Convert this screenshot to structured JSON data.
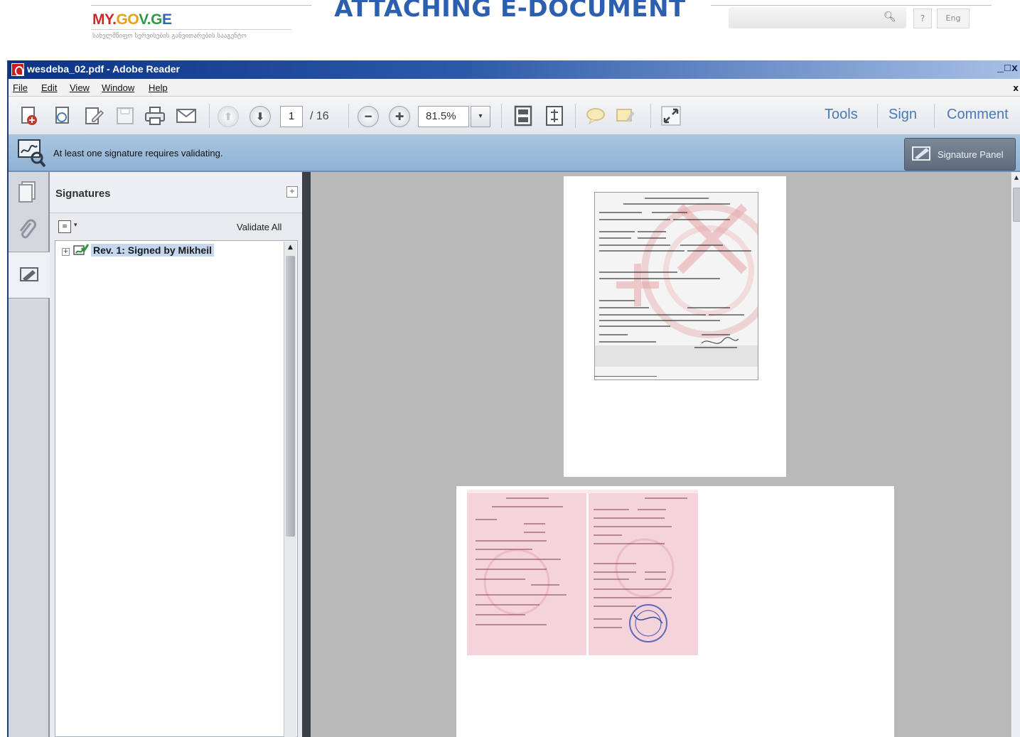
{
  "site": {
    "logo": {
      "part1": "MY.",
      "part2": "GO",
      "part3": "V.G",
      "part4": "E"
    },
    "logo_subtitle": "სახელმწიფო სერვისების განვითარების სააგენტო",
    "title": "ATTACHING E-DOCUMENT",
    "search_icon": "search-icon",
    "help_label": "?",
    "language_label": "Eng"
  },
  "window": {
    "title": "wesdeba_02.pdf - Adobe Reader",
    "controls": "_□x"
  },
  "menu": {
    "items": [
      "File",
      "Edit",
      "View",
      "Window",
      "Help"
    ],
    "close": "x"
  },
  "toolbar": {
    "current_page": "1",
    "total_pages": "/ 16",
    "zoom": "81.5%",
    "zoom_caret": "▾",
    "tools_label": "Tools",
    "sign_label": "Sign",
    "comment_label": "Comment"
  },
  "message_bar": {
    "text": "At least one signature requires validating.",
    "button_label": "Signature Panel"
  },
  "signatures_panel": {
    "title": "Signatures",
    "collapse": "+",
    "validate_all": "Validate All",
    "tree": [
      {
        "label": "Rev. 1: Signed by Mikheil",
        "expander": "+"
      }
    ]
  },
  "colors": {
    "title_accent": "#2d5fb0",
    "titlebar": "#0b3384",
    "message_bar": "#a9c6e0",
    "selection": "#c4d7ee",
    "document_background": "#b9b9b9"
  }
}
